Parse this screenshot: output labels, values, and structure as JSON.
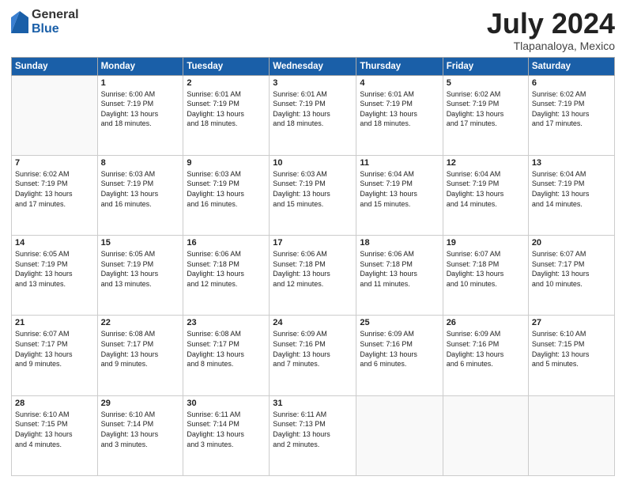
{
  "header": {
    "logo_general": "General",
    "logo_blue": "Blue",
    "title": "July 2024",
    "location": "Tlapanaloya, Mexico"
  },
  "weekdays": [
    "Sunday",
    "Monday",
    "Tuesday",
    "Wednesday",
    "Thursday",
    "Friday",
    "Saturday"
  ],
  "weeks": [
    [
      {
        "day": "",
        "info": ""
      },
      {
        "day": "1",
        "info": "Sunrise: 6:00 AM\nSunset: 7:19 PM\nDaylight: 13 hours\nand 18 minutes."
      },
      {
        "day": "2",
        "info": "Sunrise: 6:01 AM\nSunset: 7:19 PM\nDaylight: 13 hours\nand 18 minutes."
      },
      {
        "day": "3",
        "info": "Sunrise: 6:01 AM\nSunset: 7:19 PM\nDaylight: 13 hours\nand 18 minutes."
      },
      {
        "day": "4",
        "info": "Sunrise: 6:01 AM\nSunset: 7:19 PM\nDaylight: 13 hours\nand 18 minutes."
      },
      {
        "day": "5",
        "info": "Sunrise: 6:02 AM\nSunset: 7:19 PM\nDaylight: 13 hours\nand 17 minutes."
      },
      {
        "day": "6",
        "info": "Sunrise: 6:02 AM\nSunset: 7:19 PM\nDaylight: 13 hours\nand 17 minutes."
      }
    ],
    [
      {
        "day": "7",
        "info": "Sunrise: 6:02 AM\nSunset: 7:19 PM\nDaylight: 13 hours\nand 17 minutes."
      },
      {
        "day": "8",
        "info": "Sunrise: 6:03 AM\nSunset: 7:19 PM\nDaylight: 13 hours\nand 16 minutes."
      },
      {
        "day": "9",
        "info": "Sunrise: 6:03 AM\nSunset: 7:19 PM\nDaylight: 13 hours\nand 16 minutes."
      },
      {
        "day": "10",
        "info": "Sunrise: 6:03 AM\nSunset: 7:19 PM\nDaylight: 13 hours\nand 15 minutes."
      },
      {
        "day": "11",
        "info": "Sunrise: 6:04 AM\nSunset: 7:19 PM\nDaylight: 13 hours\nand 15 minutes."
      },
      {
        "day": "12",
        "info": "Sunrise: 6:04 AM\nSunset: 7:19 PM\nDaylight: 13 hours\nand 14 minutes."
      },
      {
        "day": "13",
        "info": "Sunrise: 6:04 AM\nSunset: 7:19 PM\nDaylight: 13 hours\nand 14 minutes."
      }
    ],
    [
      {
        "day": "14",
        "info": "Sunrise: 6:05 AM\nSunset: 7:19 PM\nDaylight: 13 hours\nand 13 minutes."
      },
      {
        "day": "15",
        "info": "Sunrise: 6:05 AM\nSunset: 7:19 PM\nDaylight: 13 hours\nand 13 minutes."
      },
      {
        "day": "16",
        "info": "Sunrise: 6:06 AM\nSunset: 7:18 PM\nDaylight: 13 hours\nand 12 minutes."
      },
      {
        "day": "17",
        "info": "Sunrise: 6:06 AM\nSunset: 7:18 PM\nDaylight: 13 hours\nand 12 minutes."
      },
      {
        "day": "18",
        "info": "Sunrise: 6:06 AM\nSunset: 7:18 PM\nDaylight: 13 hours\nand 11 minutes."
      },
      {
        "day": "19",
        "info": "Sunrise: 6:07 AM\nSunset: 7:18 PM\nDaylight: 13 hours\nand 10 minutes."
      },
      {
        "day": "20",
        "info": "Sunrise: 6:07 AM\nSunset: 7:17 PM\nDaylight: 13 hours\nand 10 minutes."
      }
    ],
    [
      {
        "day": "21",
        "info": "Sunrise: 6:07 AM\nSunset: 7:17 PM\nDaylight: 13 hours\nand 9 minutes."
      },
      {
        "day": "22",
        "info": "Sunrise: 6:08 AM\nSunset: 7:17 PM\nDaylight: 13 hours\nand 9 minutes."
      },
      {
        "day": "23",
        "info": "Sunrise: 6:08 AM\nSunset: 7:17 PM\nDaylight: 13 hours\nand 8 minutes."
      },
      {
        "day": "24",
        "info": "Sunrise: 6:09 AM\nSunset: 7:16 PM\nDaylight: 13 hours\nand 7 minutes."
      },
      {
        "day": "25",
        "info": "Sunrise: 6:09 AM\nSunset: 7:16 PM\nDaylight: 13 hours\nand 6 minutes."
      },
      {
        "day": "26",
        "info": "Sunrise: 6:09 AM\nSunset: 7:16 PM\nDaylight: 13 hours\nand 6 minutes."
      },
      {
        "day": "27",
        "info": "Sunrise: 6:10 AM\nSunset: 7:15 PM\nDaylight: 13 hours\nand 5 minutes."
      }
    ],
    [
      {
        "day": "28",
        "info": "Sunrise: 6:10 AM\nSunset: 7:15 PM\nDaylight: 13 hours\nand 4 minutes."
      },
      {
        "day": "29",
        "info": "Sunrise: 6:10 AM\nSunset: 7:14 PM\nDaylight: 13 hours\nand 3 minutes."
      },
      {
        "day": "30",
        "info": "Sunrise: 6:11 AM\nSunset: 7:14 PM\nDaylight: 13 hours\nand 3 minutes."
      },
      {
        "day": "31",
        "info": "Sunrise: 6:11 AM\nSunset: 7:13 PM\nDaylight: 13 hours\nand 2 minutes."
      },
      {
        "day": "",
        "info": ""
      },
      {
        "day": "",
        "info": ""
      },
      {
        "day": "",
        "info": ""
      }
    ]
  ]
}
